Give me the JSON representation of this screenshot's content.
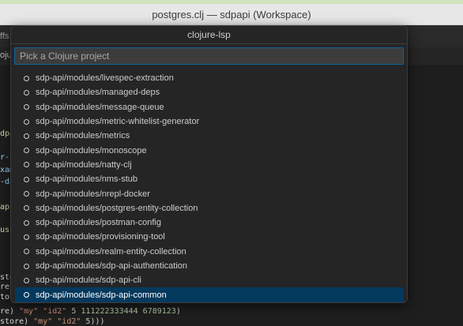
{
  "window": {
    "title": "postgres.clj — sdpapi (Workspace)"
  },
  "background": {
    "tab_fragment": "ffs",
    "breadcrumb_fragment": "oju",
    "left_fragments": [
      "dpa",
      "r-c",
      "xam",
      "-da",
      "ap",
      "usi",
      "stg",
      "re)",
      "tor"
    ],
    "code_lines": [
      {
        "prefix": "re) ",
        "str1": "\"my\"",
        "str2": "\"id2\"",
        "nums": "5 111222333444 6789123",
        "suffix": ")"
      },
      {
        "prefix": "store) ",
        "str1": "\"my\"",
        "str2": "\"id2\"",
        "nums": "5",
        "suffix": ")))"
      }
    ]
  },
  "palette": {
    "title": "clojure-lsp",
    "placeholder": "Pick a Clojure project",
    "value": "",
    "items": [
      "sdp-api/modules/livespec-extraction",
      "sdp-api/modules/managed-deps",
      "sdp-api/modules/message-queue",
      "sdp-api/modules/metric-whitelist-generator",
      "sdp-api/modules/metrics",
      "sdp-api/modules/monoscope",
      "sdp-api/modules/natty-clj",
      "sdp-api/modules/nms-stub",
      "sdp-api/modules/nrepl-docker",
      "sdp-api/modules/postgres-entity-collection",
      "sdp-api/modules/postman-config",
      "sdp-api/modules/provisioning-tool",
      "sdp-api/modules/realm-entity-collection",
      "sdp-api/modules/sdp-api-authentication",
      "sdp-api/modules/sdp-api-cli",
      "sdp-api/modules/sdp-api-common"
    ],
    "selected_index": 15,
    "item_icon": "radio-circle-icon"
  }
}
